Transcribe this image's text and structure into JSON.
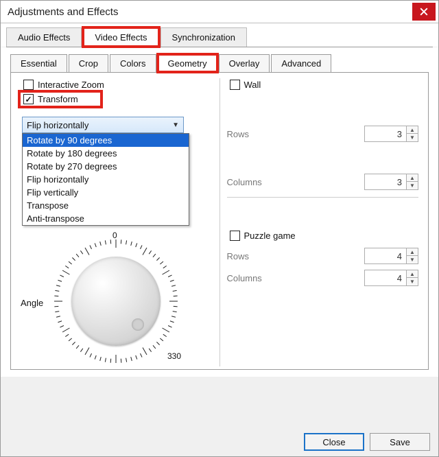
{
  "window": {
    "title": "Adjustments and Effects"
  },
  "tabs": {
    "audio": "Audio Effects",
    "video": "Video Effects",
    "sync": "Synchronization"
  },
  "subtabs": {
    "essential": "Essential",
    "crop": "Crop",
    "colors": "Colors",
    "geometry": "Geometry",
    "overlay": "Overlay",
    "advanced": "Advanced"
  },
  "geometry": {
    "interactive_zoom": {
      "label": "Interactive Zoom",
      "checked": false
    },
    "transform": {
      "label": "Transform",
      "checked": true,
      "selected": "Flip horizontally",
      "options": [
        "Rotate by 90 degrees",
        "Rotate by 180 degrees",
        "Rotate by 270 degrees",
        "Flip horizontally",
        "Flip vertically",
        "Transpose",
        "Anti-transpose"
      ]
    },
    "angle": {
      "label": "Angle",
      "ticks": {
        "top": "0",
        "br": "330"
      }
    },
    "wall": {
      "label": "Wall",
      "checked": false,
      "rows": {
        "label": "Rows",
        "value": "3"
      },
      "columns": {
        "label": "Columns",
        "value": "3"
      }
    },
    "puzzle": {
      "label": "Puzzle game",
      "checked": false,
      "rows": {
        "label": "Rows",
        "value": "4"
      },
      "columns": {
        "label": "Columns",
        "value": "4"
      }
    }
  },
  "footer": {
    "close": "Close",
    "save": "Save"
  }
}
